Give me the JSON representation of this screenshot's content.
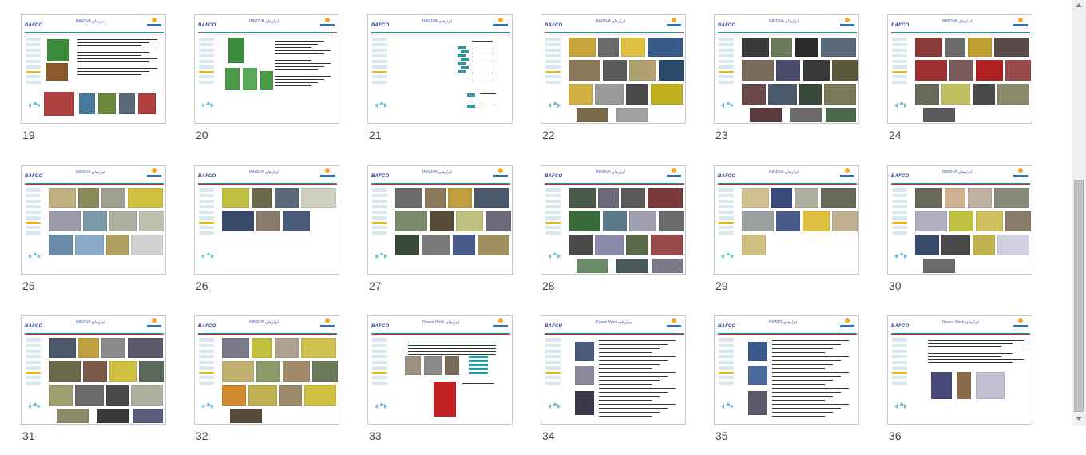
{
  "slides": [
    {
      "num": "19",
      "brand": "BAFCO",
      "title": "INNOVA  ﻿ابزارهای",
      "kind": "text-photos",
      "colors": [
        "#3c8a3c",
        "#8a5a2a",
        "#4a7a9a",
        "#6a8a3a",
        "#b04040",
        "#5a6a7a"
      ]
    },
    {
      "num": "20",
      "brand": "BAFCO",
      "title": "INNOVA  ﻿ابزارهای",
      "kind": "text-green",
      "colors": [
        "#3c8a3c",
        "#4a9a4a",
        "#5aaa5a"
      ]
    },
    {
      "num": "21",
      "brand": "BAFCO",
      "title": "INNOVA  ﻿ابزارهای",
      "kind": "list",
      "colors": [
        "#2aa0b0"
      ]
    },
    {
      "num": "22",
      "brand": "BAFCO",
      "title": "INNOVA  ﻿ابزارهای",
      "kind": "photos",
      "colors": [
        "#c8a43a",
        "#6a6a6a",
        "#e0c040",
        "#3a5a8a",
        "#8a7a5a",
        "#5a5a5a",
        "#b0a070",
        "#2a4a6a",
        "#d0b040",
        "#9a9a9a",
        "#4a4a4a",
        "#c0b020",
        "#7a6a4a",
        "#a0a0a0"
      ]
    },
    {
      "num": "23",
      "brand": "BAFCO",
      "title": "INNOVA  ﻿ابزارهای",
      "kind": "photos",
      "colors": [
        "#3a3a3a",
        "#6a7a5a",
        "#2a2a2a",
        "#5a6a7a",
        "#7a6a5a",
        "#4a4a6a",
        "#3a3a3a",
        "#5a5a3a",
        "#6a4a4a",
        "#4a5a6a",
        "#3a4a3a",
        "#7a7a5a",
        "#5a3a3a",
        "#6a6a6a",
        "#4a6a4a"
      ]
    },
    {
      "num": "24",
      "brand": "BAFCO",
      "title": "INNOVA  ﻿ابزارهای",
      "kind": "photos",
      "colors": [
        "#8a3a3a",
        "#6a6a6a",
        "#c0a030",
        "#5a4a4a",
        "#a03030",
        "#7a5a5a",
        "#b02020",
        "#9a4a4a",
        "#6a6a5a",
        "#c0c060",
        "#4a4a4a",
        "#8a8a6a",
        "#5a5a5a"
      ]
    },
    {
      "num": "25",
      "brand": "BAFCO",
      "title": "INNOVA  ﻿ابزارهای",
      "kind": "photos",
      "colors": [
        "#c0b080",
        "#8a8a5a",
        "#a0a090",
        "#d0c040",
        "#9a9aaa",
        "#7a9aaa",
        "#b0b0a0",
        "#c0c0b0",
        "#6a8aaa",
        "#8aaaca",
        "#b0a060",
        "#d0d0d0"
      ]
    },
    {
      "num": "26",
      "brand": "BAFCO",
      "title": "INNOVA  ﻿ابزارهای",
      "kind": "photos",
      "colors": [
        "#c0c040",
        "#6a6a4a",
        "#5a6a7a",
        "#d0d0c0",
        "#3a4a6a",
        "#8a7a6a",
        "#4a5a7a"
      ]
    },
    {
      "num": "27",
      "brand": "BAFCO",
      "title": "INNOVA  ﻿ابزارهای",
      "kind": "photos",
      "colors": [
        "#6a6a6a",
        "#8a7a5a",
        "#c0a040",
        "#4a5a6a",
        "#7a8a6a",
        "#5a4a3a",
        "#c0c080",
        "#6a6a7a",
        "#3a4a3a",
        "#7a7a7a",
        "#4a5a8a",
        "#a09060"
      ]
    },
    {
      "num": "28",
      "brand": "BAFCO",
      "title": "INNOVA  ﻿ابزارهای",
      "kind": "photos",
      "colors": [
        "#4a5a4a",
        "#6a6a7a",
        "#5a5a5a",
        "#7a3a3a",
        "#3a6a3a",
        "#5a7a8a",
        "#a0a0b0",
        "#6a6a6a",
        "#4a4a4a",
        "#8a8aaa",
        "#5a6a4a",
        "#9a4a4a",
        "#6a8a6a",
        "#4a5a5a",
        "#7a7a8a"
      ]
    },
    {
      "num": "29",
      "brand": "BAFCO",
      "title": "INNOVA  ﻿ابزارهای",
      "kind": "photos",
      "colors": [
        "#d0c090",
        "#3a4a7a",
        "#b0b0a0",
        "#6a6a5a",
        "#9aa0a0",
        "#4a5a8a",
        "#e0c040",
        "#c0b090",
        "#d0c080"
      ]
    },
    {
      "num": "30",
      "brand": "BAFCO",
      "title": "INNOVA  ﻿ابزارهای",
      "kind": "photos",
      "colors": [
        "#6a6a5a",
        "#d0b090",
        "#c0b0a0",
        "#8a8a7a",
        "#b0b0c0",
        "#c0c040",
        "#d0c060",
        "#8a7a6a",
        "#3a4a6a",
        "#4a4a4a",
        "#c0b050",
        "#d0d0e0",
        "#6a6a6a"
      ]
    },
    {
      "num": "31",
      "brand": "BAFCO",
      "title": "INNOVA  ﻿ابزارهای",
      "kind": "photos",
      "colors": [
        "#4a5a6a",
        "#c0a040",
        "#8a8a8a",
        "#5a5a6a",
        "#6a6a4a",
        "#7a5a4a",
        "#d0c040",
        "#5a6a5a",
        "#a0a070",
        "#6a6a6a",
        "#4a4a4a",
        "#b0b0a0",
        "#8a8a6a",
        "#3a3a3a",
        "#5a5a7a"
      ]
    },
    {
      "num": "32",
      "brand": "BAFCO",
      "title": "INNOVA  ﻿ابزارهای",
      "kind": "photos",
      "colors": [
        "#7a7a8a",
        "#c0c040",
        "#b0a090",
        "#d0c050",
        "#c0b070",
        "#8a9a6a",
        "#a08a6a",
        "#6a7a5a",
        "#d08a30",
        "#c0b050",
        "#9a8a6a",
        "#d0c040",
        "#5a4a3a"
      ]
    },
    {
      "num": "33",
      "brand": "BAFCO",
      "title": "Rosen Werk  ﻿ابزارهای",
      "kind": "doc-red",
      "colors": [
        "#a09080",
        "#8a8a8a",
        "#7a6a5a",
        "#c02020",
        "#2aa0b0"
      ]
    },
    {
      "num": "34",
      "brand": "BAFCO",
      "title": "Rosen Werk  ﻿ابزارهای",
      "kind": "doc-reels",
      "colors": [
        "#4a5a7a",
        "#8a8a9a",
        "#3a3a4a"
      ]
    },
    {
      "num": "35",
      "brand": "BAFCO",
      "title": "PRATO  ﻿ابزارهای",
      "kind": "doc-reels",
      "colors": [
        "#3a5a8a",
        "#4a6a9a",
        "#5a5a6a"
      ]
    },
    {
      "num": "36",
      "brand": "BAFCO",
      "title": "Rosen Werk  ﻿ابزارهای",
      "kind": "doc-three",
      "colors": [
        "#4a4a7a",
        "#8a6a4a",
        "#c0c0d0"
      ]
    }
  ]
}
